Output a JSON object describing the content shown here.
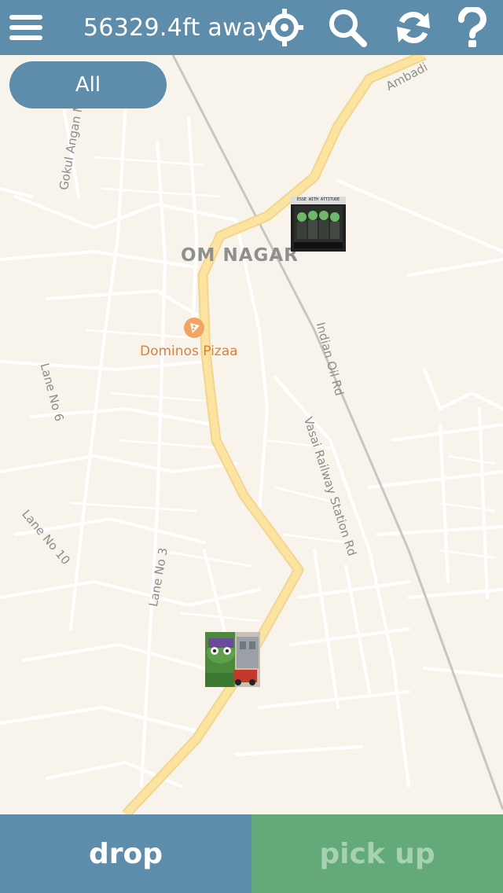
{
  "header": {
    "menu_icon": "hamburger-menu-icon",
    "distance_text": "56329.4ft away",
    "locate_icon": "crosshair-icon",
    "search_icon": "search-icon",
    "refresh_icon": "refresh-icon",
    "help_icon": "question-mark-icon"
  },
  "filter": {
    "label": "All"
  },
  "map": {
    "area_label": "Om Nagar",
    "poi": {
      "name": "Dominos Pizaa",
      "icon": "pizza-icon"
    },
    "road_labels": [
      "Gokul Angan Marg",
      "Lane No 6",
      "Lane No 10",
      "Lane No 3",
      "Indian Oil Rd",
      "Vasai Railway Station Rd",
      "Ambadi"
    ],
    "markers": [
      {
        "name": "photo-marker-group",
        "caption": "ESSE WITH ATTITUDE"
      },
      {
        "name": "photo-marker-frog"
      }
    ]
  },
  "footer": {
    "drop_label": "drop",
    "pickup_label": "pick up"
  },
  "colors": {
    "brand_blue": "#5e8cab",
    "pickup_green": "#64aa78",
    "map_bg": "#f8f4ec",
    "main_road": "#fde3a0"
  }
}
